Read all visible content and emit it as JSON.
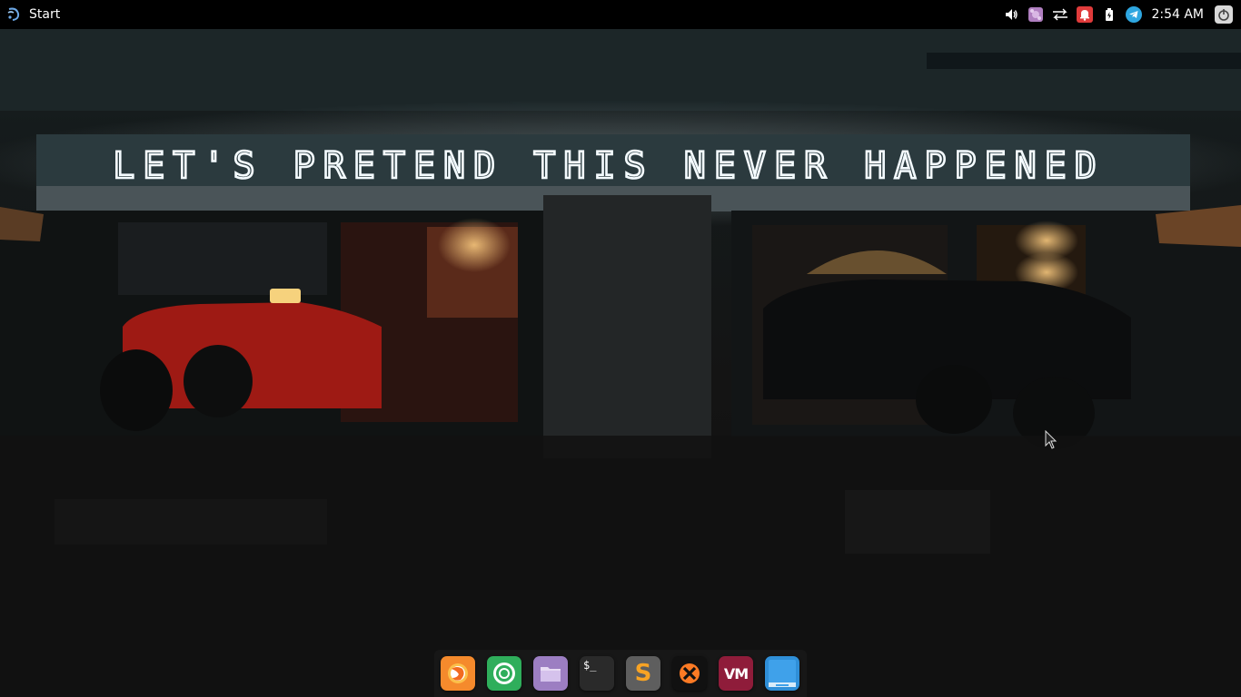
{
  "panel": {
    "start_label": "Start",
    "clock": "2:54 AM",
    "tray_icons": [
      {
        "name": "volume-icon"
      },
      {
        "name": "color-palette-icon"
      },
      {
        "name": "network-arrows-icon"
      },
      {
        "name": "notification-bell-icon"
      },
      {
        "name": "battery-icon"
      },
      {
        "name": "telegram-icon"
      },
      {
        "name": "power-icon"
      }
    ]
  },
  "wallpaper": {
    "neon_sign_text": "LET'S PRETEND THIS NEVER HAPPENED"
  },
  "dock": {
    "items": [
      {
        "name": "firefox-icon",
        "color": "#f58a2c"
      },
      {
        "name": "chrome-icon",
        "color": "#2fae5b"
      },
      {
        "name": "files-icon",
        "color": "#9c7ec2"
      },
      {
        "name": "terminal-icon",
        "color": "#2a2a2a",
        "glyph": "$_"
      },
      {
        "name": "sublime-text-icon",
        "color": "#5e5e5e",
        "glyph": "S"
      },
      {
        "name": "xampp-icon",
        "color": "#111111"
      },
      {
        "name": "vm-icon",
        "color": "#8f1c3a",
        "glyph": "VM"
      },
      {
        "name": "window-app-icon",
        "color": "#2f8fd8"
      }
    ]
  }
}
